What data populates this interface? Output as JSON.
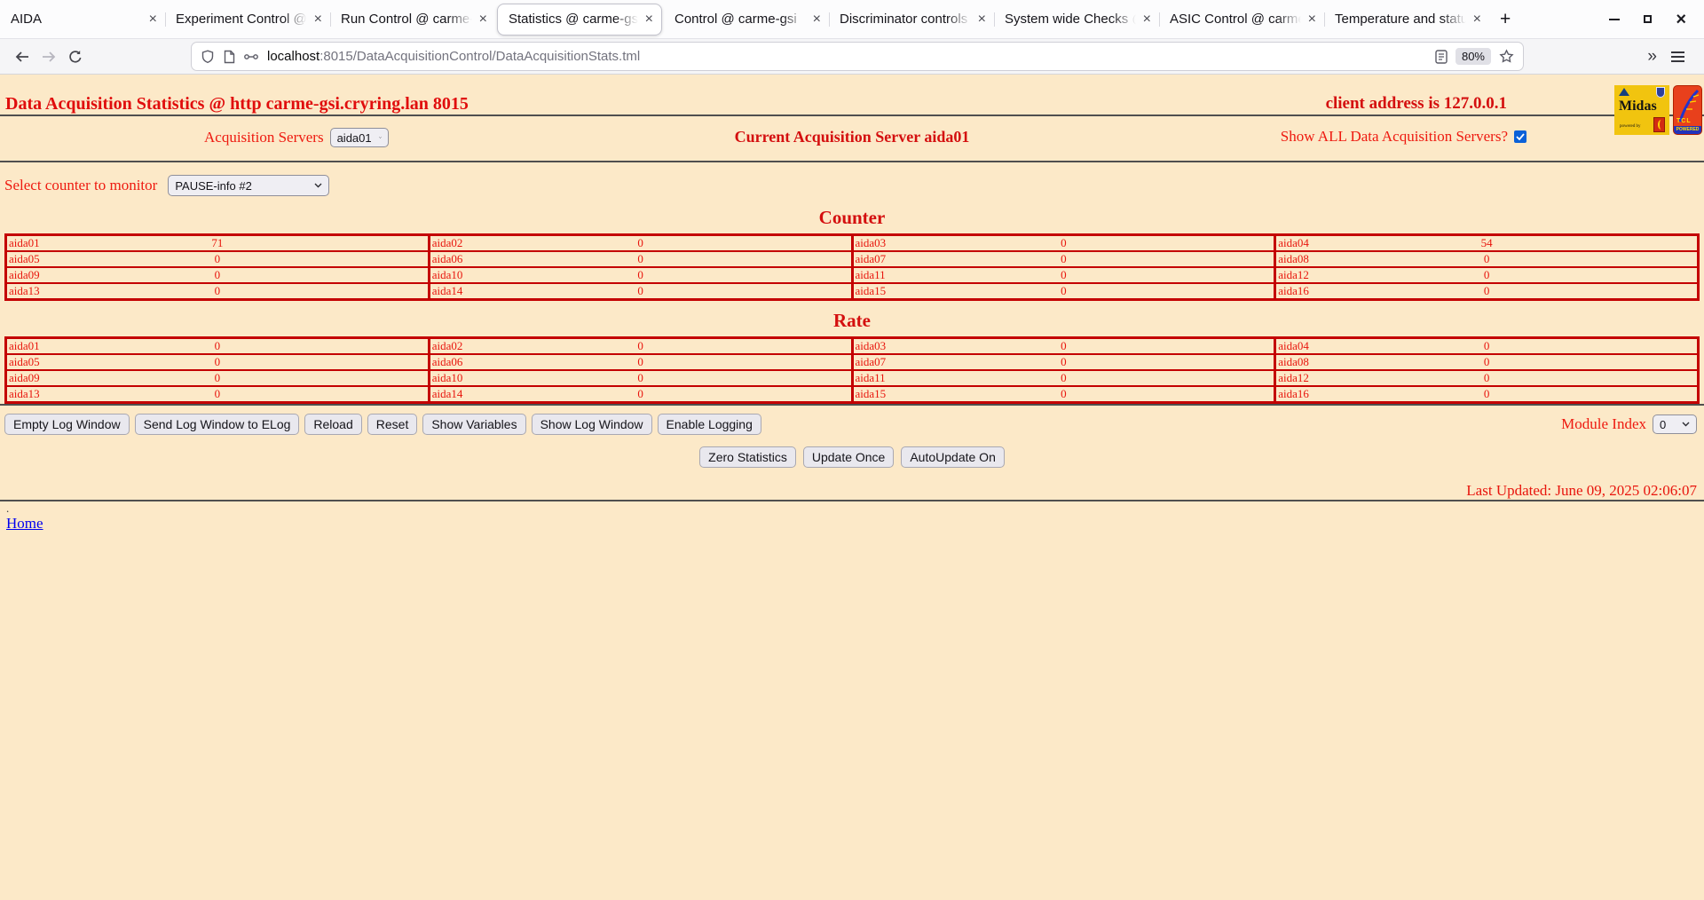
{
  "browser": {
    "tabs": [
      {
        "title": "AIDA",
        "active": false
      },
      {
        "title": "Experiment Control @ ca",
        "active": false
      },
      {
        "title": "Run Control @ carme-gs",
        "active": false
      },
      {
        "title": "Statistics @ carme-gsi",
        "active": true
      },
      {
        "title": "Control @ carme-gsi",
        "active": false
      },
      {
        "title": "Discriminator controls @",
        "active": false
      },
      {
        "title": "System wide Checks @ c",
        "active": false
      },
      {
        "title": "ASIC Control @ carme-g",
        "active": false
      },
      {
        "title": "Temperature and status s",
        "active": false
      }
    ],
    "new_tab_label": "+",
    "url": {
      "host": "localhost",
      "path": ":8015/DataAcquisitionControl/DataAcquisitionStats.tml"
    },
    "zoom_badge": "80%",
    "overflow_glyph": "»"
  },
  "header": {
    "title": "Data Acquisition Statistics @ http carme-gsi.cryring.lan 8015",
    "client_address": "client address is 127.0.0.1"
  },
  "logos": {
    "midas_text": "Midas",
    "powered_by": "powered by",
    "tcl_text": "TCL",
    "tcl_powered": "POWERED"
  },
  "controls": {
    "acquisition_servers_label": "Acquisition Servers",
    "acquisition_server_value": "aida01",
    "current_server": "Current Acquisition Server aida01",
    "show_all_label": "Show ALL Data Acquisition Servers?",
    "show_all_checked": true,
    "counter_monitor_label": "Select counter to monitor",
    "counter_monitor_value": "PAUSE-info #2",
    "module_index_label": "Module Index",
    "module_index_value": "0"
  },
  "log_buttons": [
    "Empty Log Window",
    "Send Log Window to ELog",
    "Reload",
    "Reset",
    "Show Variables",
    "Show Log Window",
    "Enable Logging"
  ],
  "update_buttons": [
    "Zero Statistics",
    "Update Once",
    "AutoUpdate On"
  ],
  "counter_table": {
    "title": "Counter",
    "rows": [
      [
        {
          "label": "aida01",
          "value": "71"
        },
        {
          "label": "aida02",
          "value": "0"
        },
        {
          "label": "aida03",
          "value": "0"
        },
        {
          "label": "aida04",
          "value": "54"
        }
      ],
      [
        {
          "label": "aida05",
          "value": "0"
        },
        {
          "label": "aida06",
          "value": "0"
        },
        {
          "label": "aida07",
          "value": "0"
        },
        {
          "label": "aida08",
          "value": "0"
        }
      ],
      [
        {
          "label": "aida09",
          "value": "0"
        },
        {
          "label": "aida10",
          "value": "0"
        },
        {
          "label": "aida11",
          "value": "0"
        },
        {
          "label": "aida12",
          "value": "0"
        }
      ],
      [
        {
          "label": "aida13",
          "value": "0"
        },
        {
          "label": "aida14",
          "value": "0"
        },
        {
          "label": "aida15",
          "value": "0"
        },
        {
          "label": "aida16",
          "value": "0"
        }
      ]
    ]
  },
  "rate_table": {
    "title": "Rate",
    "rows": [
      [
        {
          "label": "aida01",
          "value": "0"
        },
        {
          "label": "aida02",
          "value": "0"
        },
        {
          "label": "aida03",
          "value": "0"
        },
        {
          "label": "aida04",
          "value": "0"
        }
      ],
      [
        {
          "label": "aida05",
          "value": "0"
        },
        {
          "label": "aida06",
          "value": "0"
        },
        {
          "label": "aida07",
          "value": "0"
        },
        {
          "label": "aida08",
          "value": "0"
        }
      ],
      [
        {
          "label": "aida09",
          "value": "0"
        },
        {
          "label": "aida10",
          "value": "0"
        },
        {
          "label": "aida11",
          "value": "0"
        },
        {
          "label": "aida12",
          "value": "0"
        }
      ],
      [
        {
          "label": "aida13",
          "value": "0"
        },
        {
          "label": "aida14",
          "value": "0"
        },
        {
          "label": "aida15",
          "value": "0"
        },
        {
          "label": "aida16",
          "value": "0"
        }
      ]
    ]
  },
  "footer": {
    "last_updated": "Last Updated: June 09, 2025 02:06:07",
    "dot": ".",
    "home_link": "Home"
  },
  "colors": {
    "page_bg": "#fce9c8",
    "text_red": "#e8150d",
    "bold_red": "#d40f0f",
    "table_border": "#c40000",
    "link_blue": "#0000ee",
    "checkbox_blue": "#0b61d8"
  }
}
